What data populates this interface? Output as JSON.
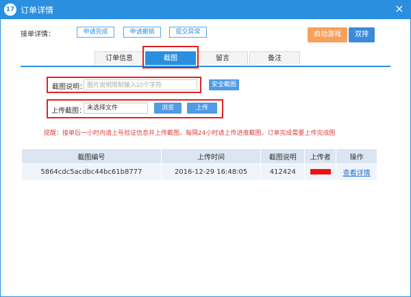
{
  "window": {
    "title": "订单详情",
    "logo_text": "17",
    "close_symbol": "×"
  },
  "toolbar": {
    "label": "接单详情：",
    "buttons": [
      "申请完成",
      "申请撤销",
      "提交异常"
    ],
    "start_game": "启动游戏",
    "dual": "双排"
  },
  "tabs": [
    {
      "label": "订单信息",
      "active": false
    },
    {
      "label": "截图",
      "active": true
    },
    {
      "label": "留言",
      "active": false
    },
    {
      "label": "备注",
      "active": false
    }
  ],
  "screenshot_desc": {
    "label": "截图说明：",
    "placeholder": "图片说明限制输入10个字符",
    "button": "安全截图"
  },
  "upload": {
    "label": "上传截图：",
    "value": "未选择文件",
    "browse": "浏览",
    "upload": "上传"
  },
  "tip": "提醒：接单后一小时内请上号验证信息并上传截图，每隔24小时请上传进度截图，订单完成需要上传完成图",
  "table": {
    "headers": [
      "截图编号",
      "上传时间",
      "截图说明",
      "上传者",
      "操作"
    ],
    "rows": [
      {
        "id": "5864cdc5acdbc44bc61b8777",
        "time": "2016-12-29 16:48:05",
        "desc": "412424",
        "action": "查看详情"
      }
    ]
  },
  "colors": {
    "primary": "#2b8fe0",
    "orange": "#f6a05a",
    "highlight_red": "#e02020",
    "tip_red": "#e04040"
  }
}
